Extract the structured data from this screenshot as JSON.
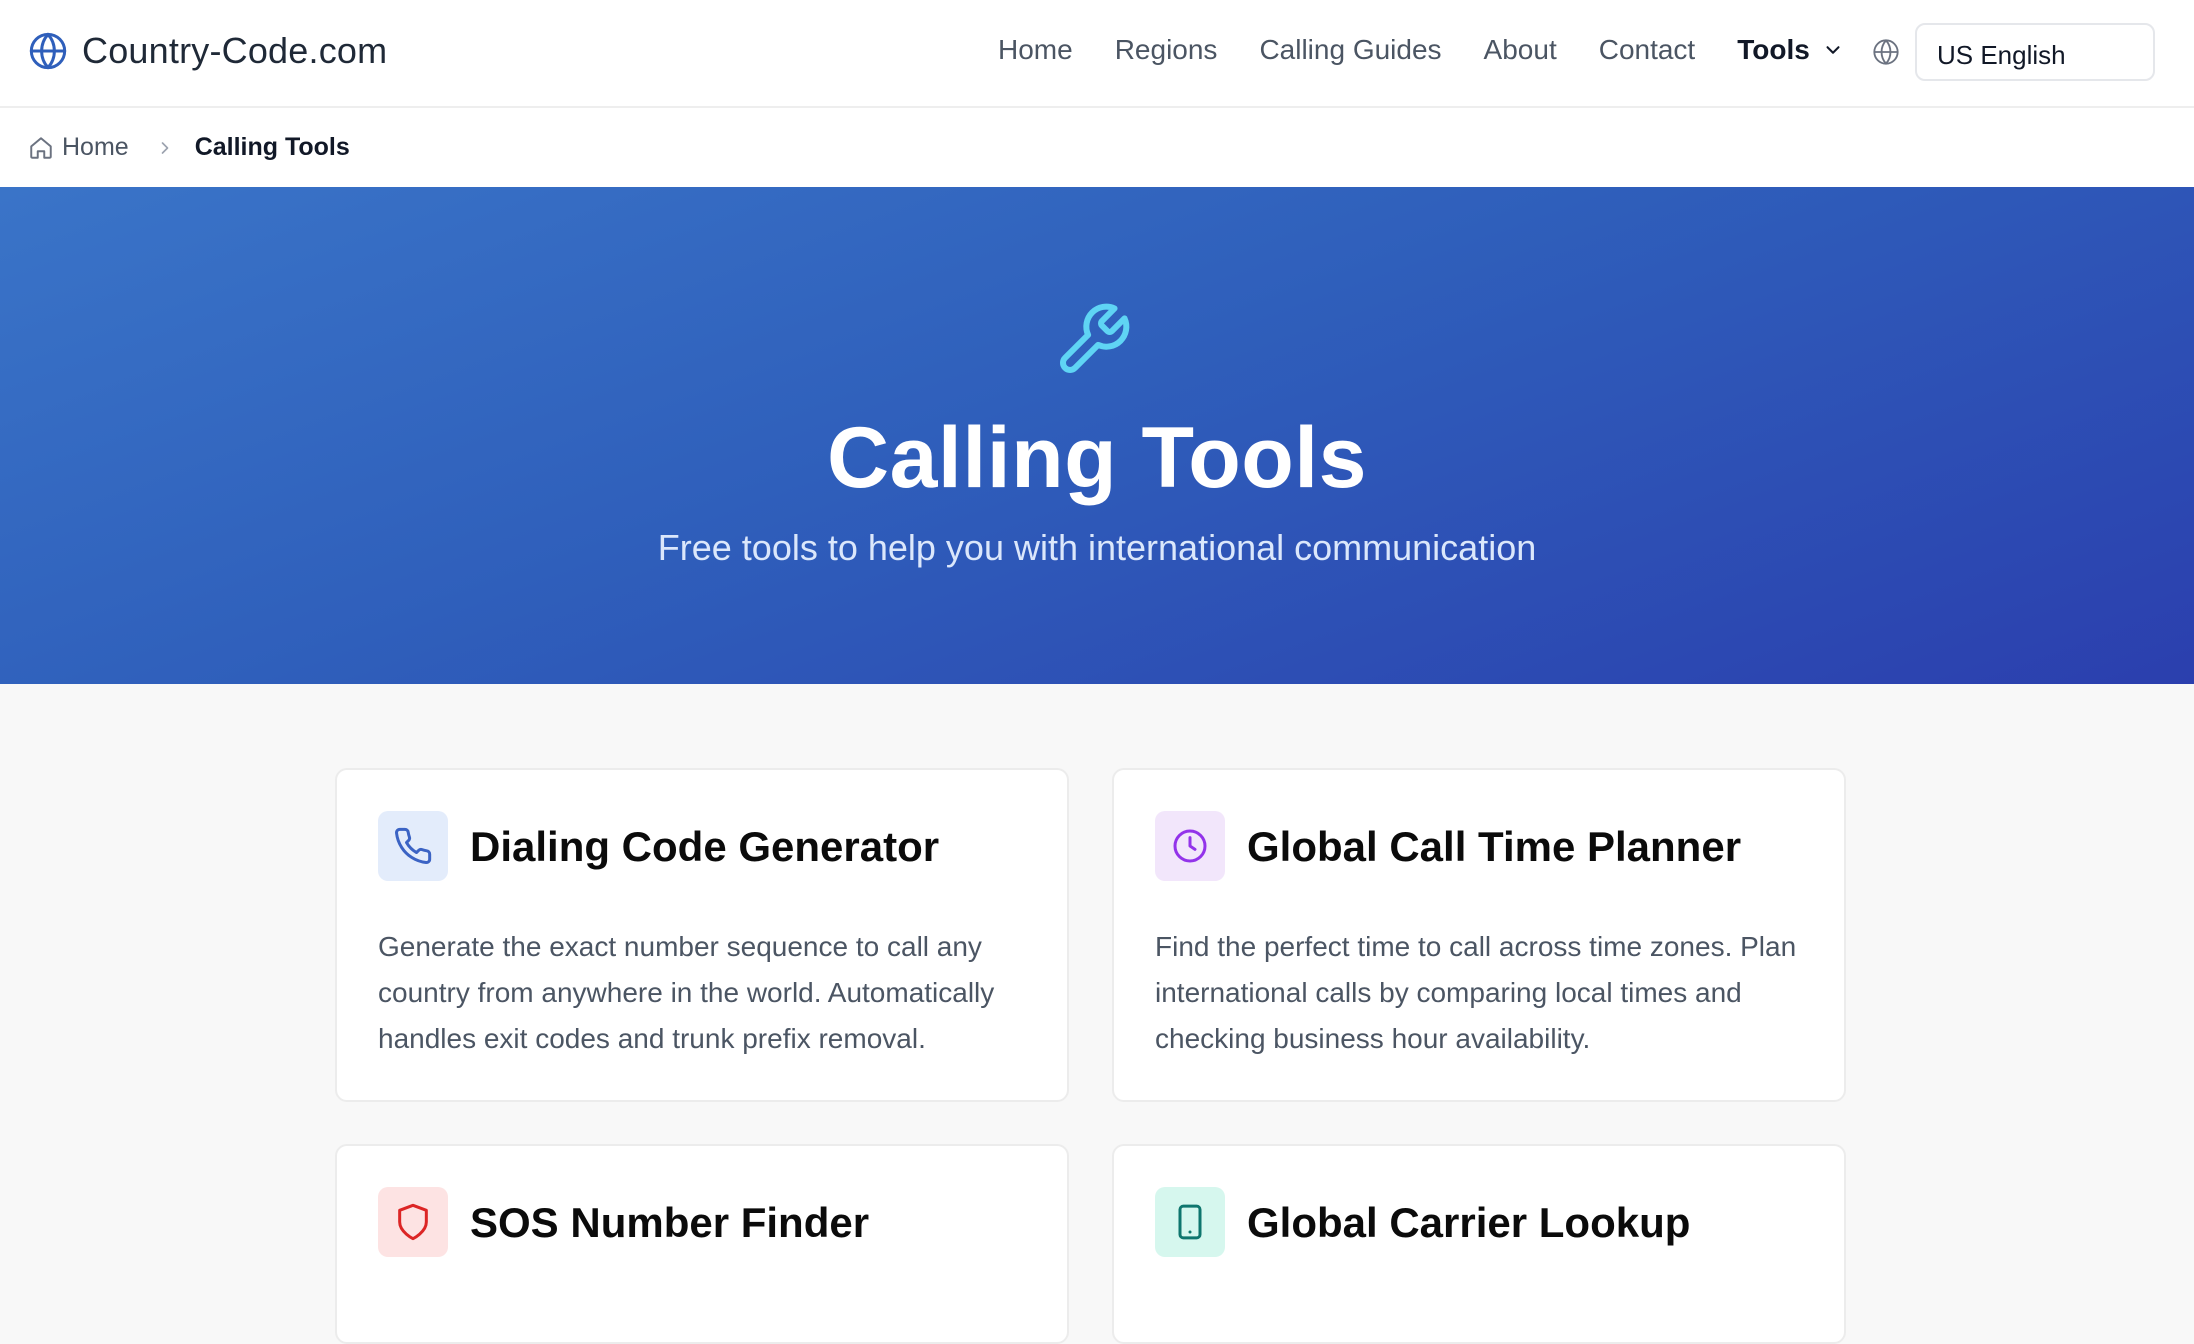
{
  "header": {
    "logo_text": "Country-Code.com",
    "nav": [
      "Home",
      "Regions",
      "Calling Guides",
      "About",
      "Contact"
    ],
    "tools_label": "Tools",
    "language": "US English"
  },
  "breadcrumb": {
    "home": "Home",
    "current": "Calling Tools"
  },
  "hero": {
    "title": "Calling Tools",
    "subtitle": "Free tools to help you with international communication"
  },
  "cards": [
    {
      "title": "Dialing Code Generator",
      "description": "Generate the exact number sequence to call any country from anywhere in the world. Automatically handles exit codes and trunk prefix removal.",
      "icon": "phone-icon",
      "accent": "#3b63c4",
      "bg": "#e3ecfb"
    },
    {
      "title": "Global Call Time Planner",
      "description": "Find the perfect time to call across time zones. Plan international calls by comparing local times and checking business hour availability.",
      "icon": "clock-icon",
      "accent": "#9333ea",
      "bg": "#f2e6fb"
    },
    {
      "title": "SOS Number Finder",
      "description": "",
      "icon": "shield-icon",
      "accent": "#dc2626",
      "bg": "#fde3e3"
    },
    {
      "title": "Global Carrier Lookup",
      "description": "",
      "icon": "tablet-icon",
      "accent": "#0f766e",
      "bg": "#d6f7ee"
    }
  ]
}
